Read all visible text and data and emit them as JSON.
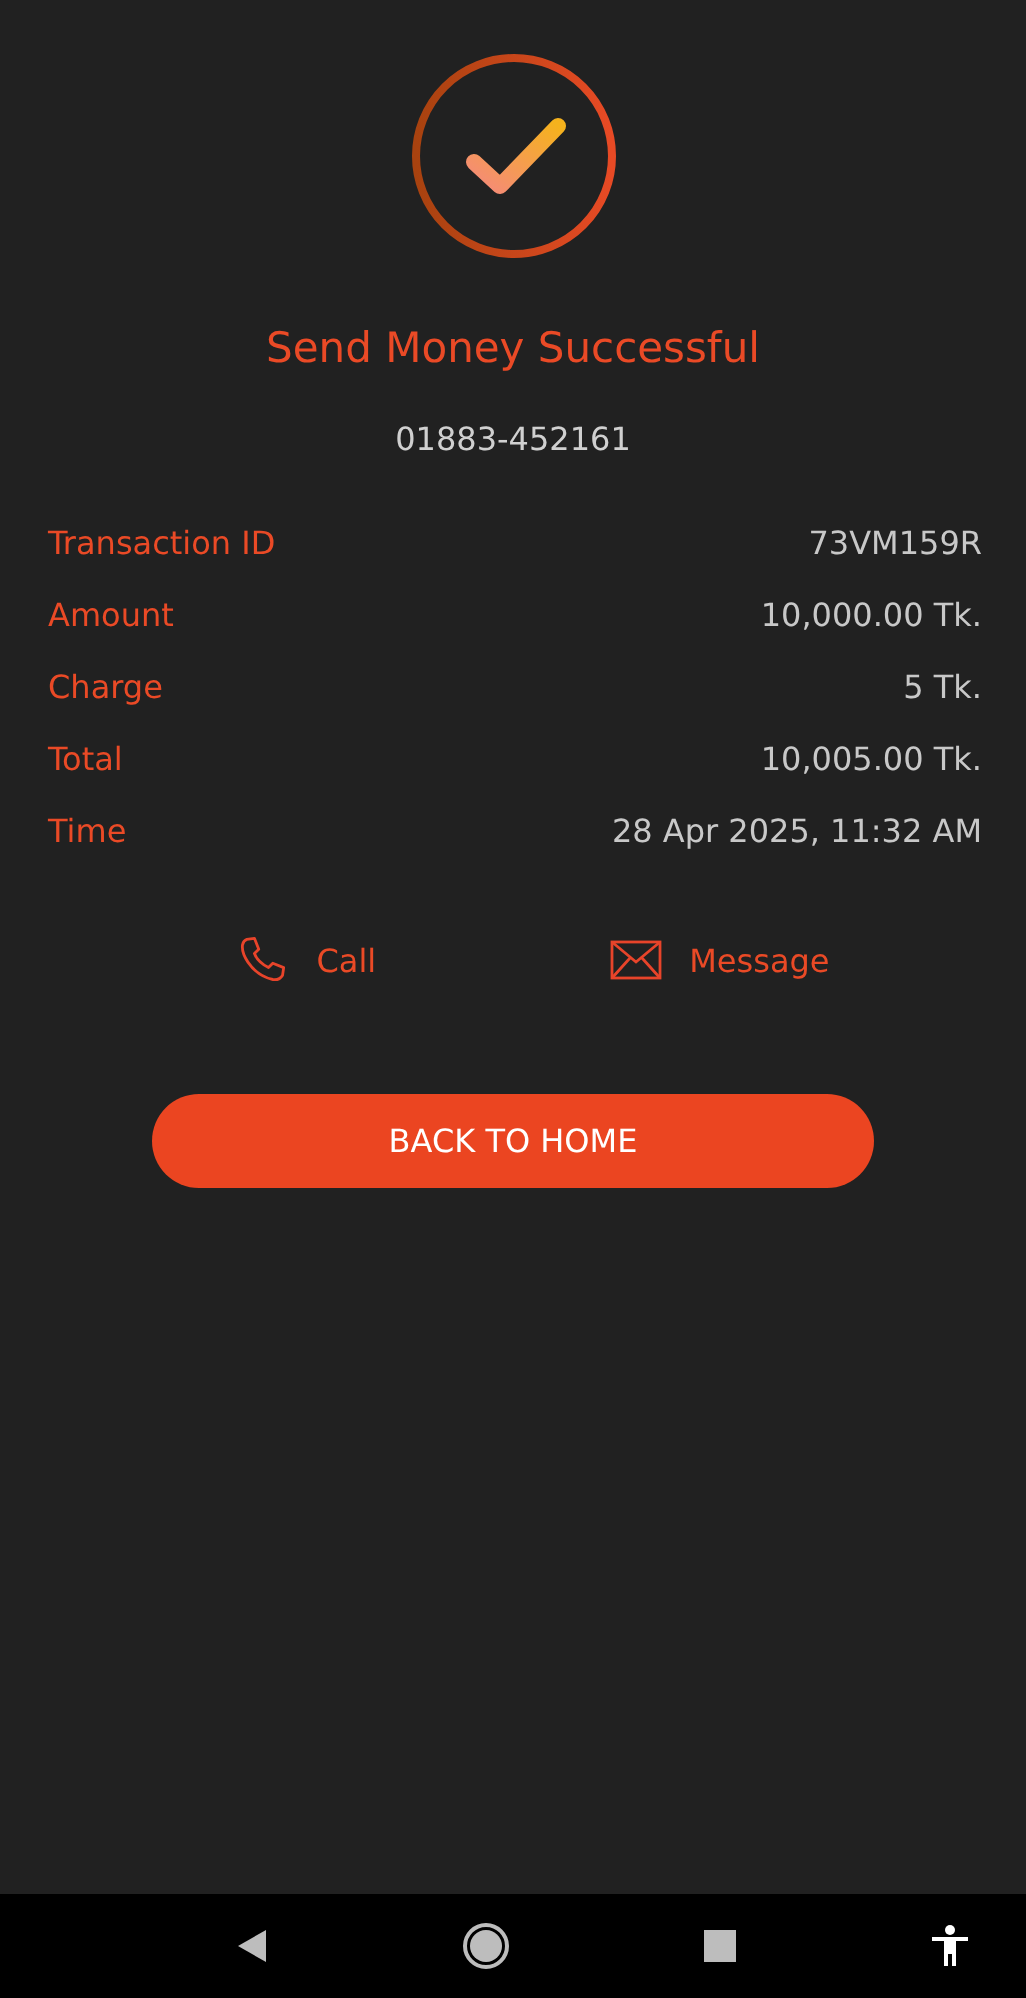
{
  "title": "Send Money Successful",
  "recipient": "01883-452161",
  "details": [
    {
      "label": "Transaction ID",
      "value": "73VM159R"
    },
    {
      "label": "Amount",
      "value": "10,000.00 Tk."
    },
    {
      "label": "Charge",
      "value": "5 Tk."
    },
    {
      "label": "Total",
      "value": "10,005.00 Tk."
    },
    {
      "label": "Time",
      "value": "28 Apr 2025, 11:32 AM"
    }
  ],
  "actions": [
    {
      "kind": "call",
      "label": "Call"
    },
    {
      "kind": "message",
      "label": "Message"
    }
  ],
  "primary_button": "BACK TO HOME"
}
